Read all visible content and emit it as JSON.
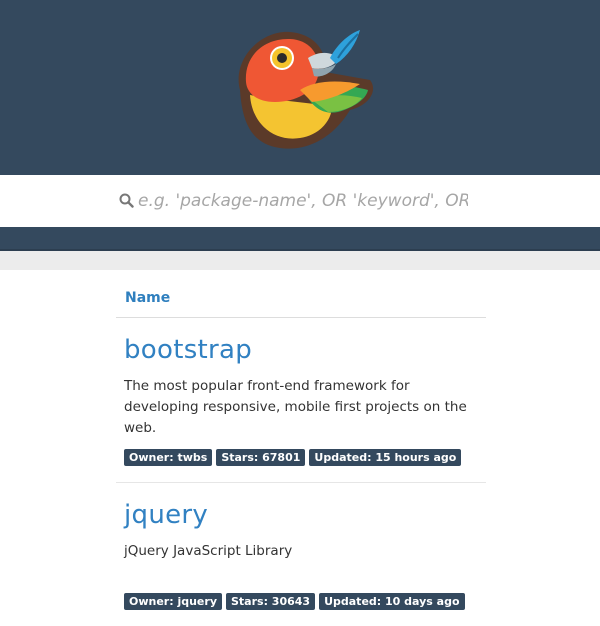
{
  "search": {
    "placeholder": "e.g. 'package-name', OR 'keyword', OR 'keyword'"
  },
  "results": {
    "column_header": "Name",
    "packages": [
      {
        "name": "bootstrap",
        "description": "The most popular front-end framework for developing responsive, mobile first projects on the web.",
        "owner": "Owner: twbs",
        "stars": "Stars: 67801",
        "updated": "Updated: 15 hours ago"
      },
      {
        "name": "jquery",
        "description": "jQuery JavaScript Library",
        "owner": "Owner: jquery",
        "stars": "Stars: 30643",
        "updated": "Updated: 10 days ago"
      }
    ]
  },
  "colors": {
    "header_bg": "#34495e",
    "link": "#3181c2",
    "badge_bg": "#34495e"
  }
}
